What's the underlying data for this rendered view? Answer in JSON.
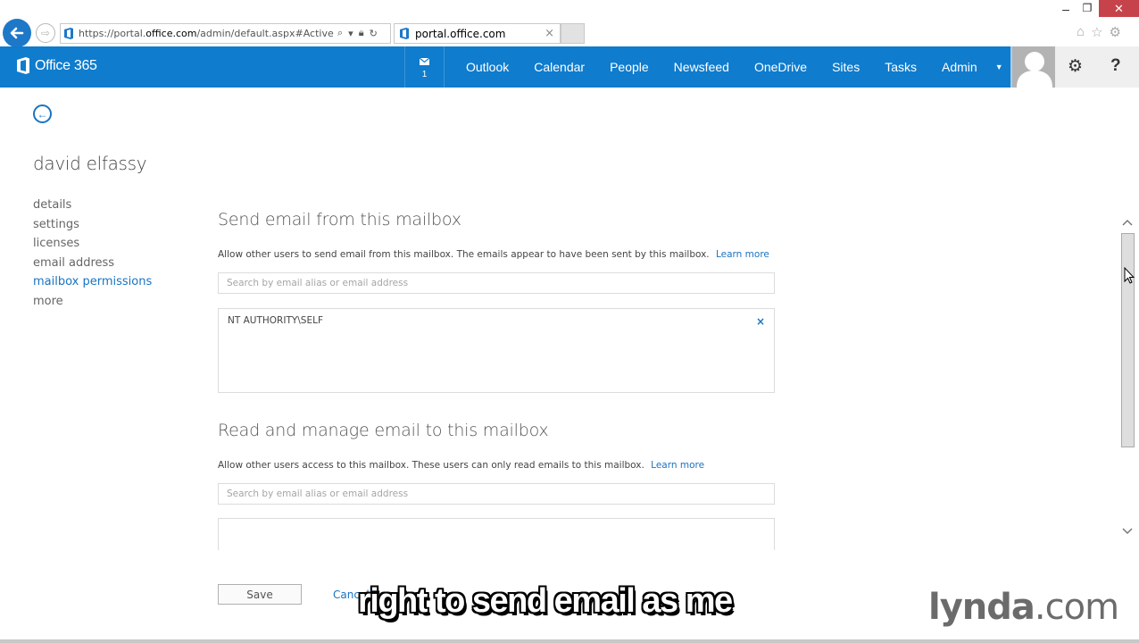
{
  "browser": {
    "url_prefix": "https://portal.",
    "url_domain": "office.com",
    "url_path": "/admin/default.aspx#ActiveUser",
    "tab_title": "portal.office.com",
    "tab_close": "×",
    "window_controls": {
      "minimize": "–",
      "restore": "❐",
      "close": "✕"
    },
    "toolbar_icons": [
      "home-icon",
      "favorites-star-icon",
      "settings-gear-icon"
    ]
  },
  "header": {
    "brand": "Office 365",
    "mail_count": "1",
    "nav": [
      "Outlook",
      "Calendar",
      "People",
      "Newsfeed",
      "OneDrive",
      "Sites",
      "Tasks",
      "Admin"
    ],
    "admin_caret": "▼",
    "settings_glyph": "⚙",
    "help_glyph": "?",
    "brand_color": "#0f7ccd"
  },
  "page": {
    "user_name": "david elfassy",
    "left_nav": [
      {
        "label": "details",
        "active": false
      },
      {
        "label": "settings",
        "active": false
      },
      {
        "label": "licenses",
        "active": false
      },
      {
        "label": "email address",
        "active": false
      },
      {
        "label": "mailbox permissions",
        "active": true
      },
      {
        "label": "more",
        "active": false
      }
    ],
    "sections": [
      {
        "title": "Send email from this mailbox",
        "description": "Allow other users to send email from this mailbox. The emails appear to have been sent by this mailbox.",
        "learn_more": "Learn more",
        "search_placeholder": "Search by email alias or email address",
        "search_value": "",
        "entries": [
          {
            "name": "NT AUTHORITY\\SELF",
            "remove": "×"
          }
        ]
      },
      {
        "title": "Read and manage email to this mailbox",
        "description": "Allow other users access to this mailbox. These users can only read emails to this mailbox.",
        "learn_more": "Learn more",
        "search_placeholder": "Search by email alias or email address",
        "search_value": "",
        "entries": []
      }
    ],
    "save_label": "Save",
    "cancel_label": "Cancel"
  },
  "overlay": {
    "caption": "right to send email as me",
    "watermark_bold": "lynda",
    "watermark_rest": ".com"
  },
  "scrollbar": {
    "position_fraction": 0.05,
    "thumb_fraction": 0.62,
    "up": "⌃",
    "down": "⌄"
  }
}
